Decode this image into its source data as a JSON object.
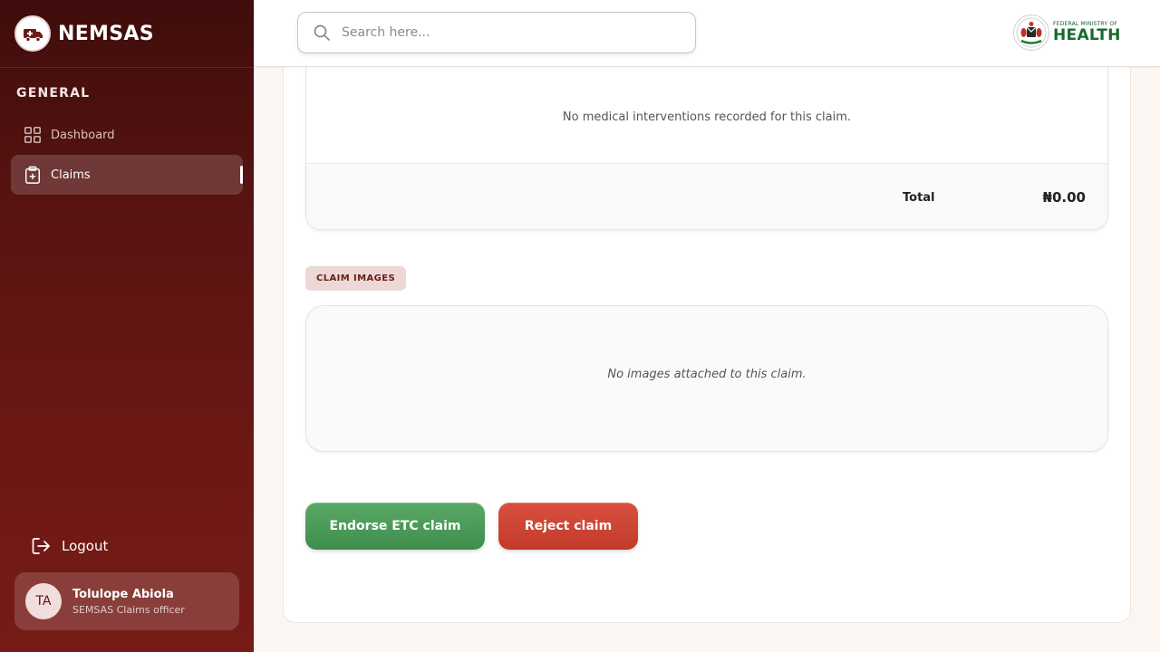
{
  "colors": {
    "sidebar_dark": "#3f0d0c",
    "sidebar_light": "#761b16",
    "accent_green": "#3e8e4d",
    "accent_red": "#c23a2a",
    "badge_bg": "#ecd8d6",
    "badge_text": "#6b1d18"
  },
  "sidebar": {
    "brand_name": "NEMSAS",
    "brand_icon": "ambulance-logo-icon",
    "section_label": "GENERAL",
    "nav": [
      {
        "label": "Dashboard",
        "icon": "grid-icon",
        "active": false
      },
      {
        "label": "Claims",
        "icon": "clipboard-plus-icon",
        "active": true
      }
    ],
    "logout_label": "Logout",
    "user": {
      "initials": "TA",
      "name": "Tolulope Abiola",
      "role": "SEMSAS Claims officer"
    }
  },
  "header": {
    "search_placeholder": "Search here...",
    "ministry_small": "FEDERAL MINISTRY OF",
    "ministry_big": "HEALTH"
  },
  "claim": {
    "interventions_empty": "No medical interventions recorded for this claim.",
    "total_label": "Total",
    "total_value": "₦0.00",
    "images_badge": "CLAIM IMAGES",
    "images_empty": "No images attached to this claim.",
    "endorse_label": "Endorse ETC claim",
    "reject_label": "Reject claim"
  }
}
